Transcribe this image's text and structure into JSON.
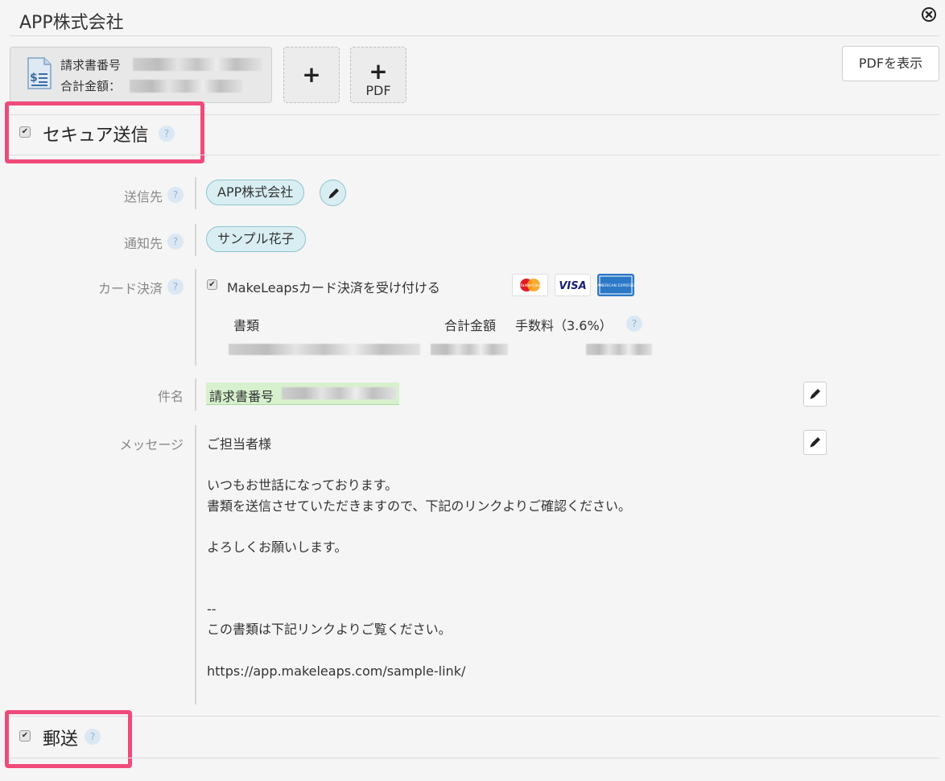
{
  "header": {
    "title": "APP株式会社",
    "close_icon": "close-circle-icon"
  },
  "document": {
    "line1_label": "請求書番号",
    "line2_label": "合計金額：",
    "icon": "invoice-document-icon"
  },
  "add_buttons": {
    "add_label": "+",
    "add_pdf_plus": "+",
    "add_pdf_label": "PDF"
  },
  "toolbar": {
    "show_pdf_label": "PDFを表示"
  },
  "secure_send": {
    "title": "セキュア送信",
    "help": "?",
    "checked": true
  },
  "form": {
    "recipient": {
      "label": "送信先",
      "help": "?",
      "value": "APP株式会社"
    },
    "notify": {
      "label": "通知先",
      "help": "?",
      "value": "サンプル花子"
    },
    "card_payment": {
      "label": "カード決済",
      "help": "?",
      "checkbox_label": "MakeLeapsカード決済を受け付ける",
      "checked": true,
      "logos": [
        "mastercard-logo",
        "visa-logo",
        "amex-logo"
      ],
      "logo_texts": [
        "MasterCard",
        "VISA",
        "AMERICAN EXPRESS"
      ],
      "table_headers": {
        "document": "書類",
        "total": "合計金額",
        "fee": "手数料（3.6%）"
      },
      "fee_help": "?"
    },
    "subject": {
      "label": "件名",
      "value": "請求書番号"
    },
    "message": {
      "label": "メッセージ",
      "lines": [
        "ご担当者様",
        "",
        "いつもお世話になっております。",
        "書類を送信させていただきますので、下記のリンクよりご確認ください。",
        "",
        "よろしくお願いします。",
        "",
        "",
        "--",
        "この書類は下記リンクよりご覧ください。",
        "",
        "https://app.makeleaps.com/sample-link/"
      ]
    }
  },
  "postal": {
    "title": "郵送",
    "help": "?",
    "checked": true
  },
  "colors": {
    "highlight": "#f04a7a",
    "pill_bg": "#d9eef2",
    "pill_border": "#8cc4ce",
    "subject_bg": "#d7f1cf"
  }
}
